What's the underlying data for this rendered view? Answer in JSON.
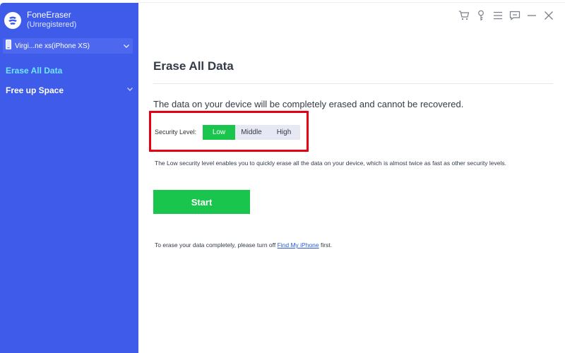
{
  "app": {
    "name": "FoneEraser",
    "status": "(Unregistered)"
  },
  "sidebar": {
    "device_label": "Virgi...ne xs(iPhone XS)",
    "items": [
      {
        "label": "Erase All Data",
        "active": true
      },
      {
        "label": "Free up Space",
        "active": false
      }
    ]
  },
  "window_controls": [
    "cart-icon",
    "key-icon",
    "menu-icon",
    "feedback-icon",
    "minimize-icon",
    "close-icon"
  ],
  "main": {
    "title": "Erase All Data",
    "warning": "The data on your device will be completely erased and cannot be recovered.",
    "security_label": "Security Level:",
    "levels": [
      "Low",
      "Middle",
      "High"
    ],
    "selected_level": "Low",
    "description": "The Low security level enables you to quickly erase all the data on your device, which is almost twice as fast as other security levels.",
    "start_label": "Start",
    "note_prefix": "To erase your data completely, please turn off",
    "note_link": "Find My iPhone",
    "note_suffix": "first."
  },
  "colors": {
    "sidebar": "#3e5bea",
    "accent_green": "#19c54d",
    "active_nav": "#71e5ff",
    "highlight_red": "#e60012",
    "link": "#2a59e0"
  }
}
